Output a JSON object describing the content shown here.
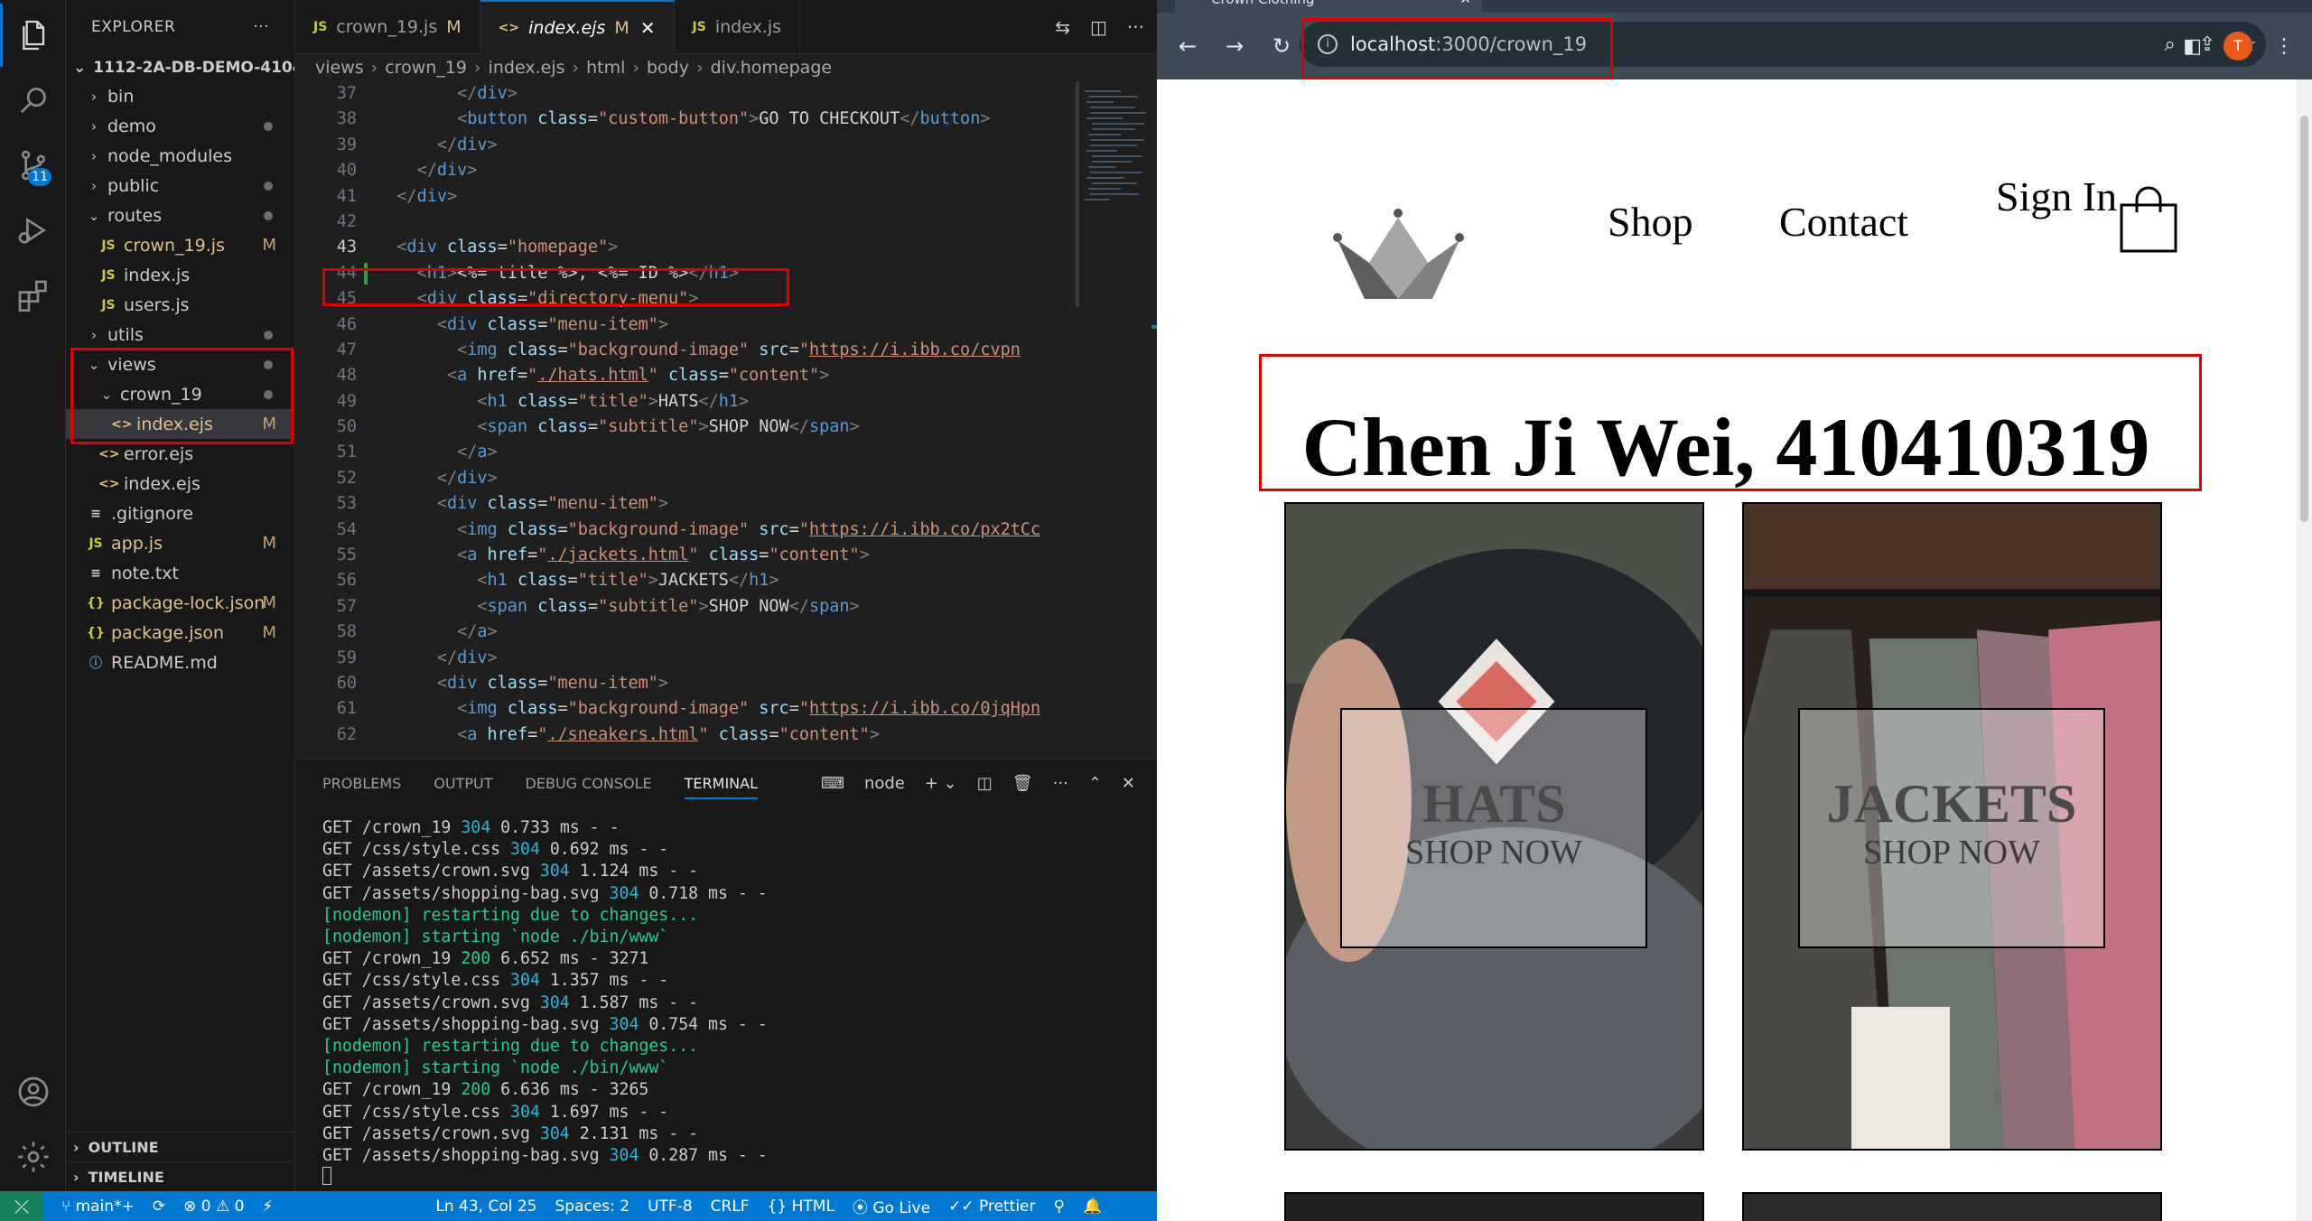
{
  "vscode": {
    "explorer": {
      "header": "EXPLORER",
      "more": "···",
      "project": "1112-2A-DB-DEMO-41041...",
      "tree": [
        {
          "label": "bin",
          "kind": "folder",
          "depth": 1,
          "open": false,
          "status": ""
        },
        {
          "label": "demo",
          "kind": "folder",
          "depth": 1,
          "open": false,
          "status": "dot"
        },
        {
          "label": "node_modules",
          "kind": "folder",
          "depth": 1,
          "open": false,
          "status": ""
        },
        {
          "label": "public",
          "kind": "folder",
          "depth": 1,
          "open": false,
          "status": "dot"
        },
        {
          "label": "routes",
          "kind": "folder",
          "depth": 1,
          "open": true,
          "status": "dot"
        },
        {
          "label": "crown_19.js",
          "kind": "js",
          "depth": 2,
          "status": "M"
        },
        {
          "label": "index.js",
          "kind": "js",
          "depth": 2,
          "status": ""
        },
        {
          "label": "users.js",
          "kind": "js",
          "depth": 2,
          "status": ""
        },
        {
          "label": "utils",
          "kind": "folder",
          "depth": 1,
          "open": false,
          "status": "dot"
        },
        {
          "label": "views",
          "kind": "folder",
          "depth": 1,
          "open": true,
          "status": "dot"
        },
        {
          "label": "crown_19",
          "kind": "folder",
          "depth": 2,
          "open": true,
          "status": "dot"
        },
        {
          "label": "index.ejs",
          "kind": "ejs",
          "depth": 3,
          "status": "M",
          "selected": true
        },
        {
          "label": "error.ejs",
          "kind": "ejs",
          "depth": 2,
          "status": ""
        },
        {
          "label": "index.ejs",
          "kind": "ejs",
          "depth": 2,
          "status": ""
        },
        {
          "label": ".gitignore",
          "kind": "txt",
          "depth": 1,
          "status": ""
        },
        {
          "label": "app.js",
          "kind": "js",
          "depth": 1,
          "status": "M"
        },
        {
          "label": "note.txt",
          "kind": "txt",
          "depth": 1,
          "status": ""
        },
        {
          "label": "package-lock.json",
          "kind": "json",
          "depth": 1,
          "status": "M"
        },
        {
          "label": "package.json",
          "kind": "json",
          "depth": 1,
          "status": "M"
        },
        {
          "label": "README.md",
          "kind": "info",
          "depth": 1,
          "status": ""
        }
      ],
      "outline": "OUTLINE",
      "timeline": "TIMELINE"
    },
    "tabs": [
      {
        "icon": "JS",
        "label": "crown_19.js",
        "mod": "M",
        "active": false
      },
      {
        "icon": "<>",
        "label": "index.ejs",
        "mod": "M",
        "active": true
      },
      {
        "icon": "JS",
        "label": "index.js",
        "mod": "",
        "active": false
      }
    ],
    "breadcrumb": [
      "views",
      "crown_19",
      "index.ejs",
      "html",
      "body",
      "div.homepage"
    ],
    "code": [
      {
        "n": "37",
        "html": "        <span class='tg'>&lt;/</span><span class='tn'>div</span><span class='tg'>&gt;</span>"
      },
      {
        "n": "38",
        "html": "        <span class='tg'>&lt;</span><span class='tn'>button</span> <span class='at'>class</span><span class='tx'>=</span><span class='sv'>\"custom-button\"</span><span class='tg'>&gt;</span><span class='tx'>GO TO CHECKOUT</span><span class='tg'>&lt;/</span><span class='tn'>button</span><span class='tg'>&gt;</span>"
      },
      {
        "n": "39",
        "html": "      <span class='tg'>&lt;/</span><span class='tn'>div</span><span class='tg'>&gt;</span>"
      },
      {
        "n": "40",
        "html": "    <span class='tg'>&lt;/</span><span class='tn'>div</span><span class='tg'>&gt;</span>"
      },
      {
        "n": "41",
        "html": "  <span class='tg'>&lt;/</span><span class='tn'>div</span><span class='tg'>&gt;</span>"
      },
      {
        "n": "42",
        "html": ""
      },
      {
        "n": "43",
        "html": "  <span class='tg'>&lt;</span><span class='tn'>div</span> <span class='at'>class</span><span class='tx'>=</span><span class='sv'>\"homepage\"</span><span class='tg'>&gt;</span>"
      },
      {
        "n": "44",
        "html": "    <span class='tg'>&lt;</span><span class='tn'>h1</span><span class='tg'>&gt;</span><span class='tx'>&lt;%= title %&gt;, &lt;%= ID %&gt;</span><span class='tg'>&lt;/</span><span class='tn'>h1</span><span class='tg'>&gt;</span>"
      },
      {
        "n": "45",
        "html": "    <span class='tg'>&lt;</span><span class='tn'>div</span> <span class='at'>class</span><span class='tx'>=</span><span class='sv'>\"directory-menu\"</span><span class='tg'>&gt;</span>"
      },
      {
        "n": "46",
        "html": "      <span class='tg'>&lt;</span><span class='tn'>div</span> <span class='at'>class</span><span class='tx'>=</span><span class='sv'>\"menu-item\"</span><span class='tg'>&gt;</span>"
      },
      {
        "n": "47",
        "html": "        <span class='tg'>&lt;</span><span class='tn'>img</span> <span class='at'>class</span><span class='tx'>=</span><span class='sv'>\"background-image\"</span> <span class='at'>src</span><span class='tx'>=</span><span class='sv'>\"</span><span class='ul'>https://i.ibb.co/cvpn</span>"
      },
      {
        "n": "48",
        "html": "       <span class='tg'>&lt;</span><span class='tn'>a</span> <span class='at'>href</span><span class='tx'>=</span><span class='sv'>\"</span><span class='ul'>./hats.html</span><span class='sv'>\"</span> <span class='at'>class</span><span class='tx'>=</span><span class='sv'>\"content\"</span><span class='tg'>&gt;</span>"
      },
      {
        "n": "49",
        "html": "          <span class='tg'>&lt;</span><span class='tn'>h1</span> <span class='at'>class</span><span class='tx'>=</span><span class='sv'>\"title\"</span><span class='tg'>&gt;</span><span class='tx'>HATS</span><span class='tg'>&lt;/</span><span class='tn'>h1</span><span class='tg'>&gt;</span>"
      },
      {
        "n": "50",
        "html": "          <span class='tg'>&lt;</span><span class='tn'>span</span> <span class='at'>class</span><span class='tx'>=</span><span class='sv'>\"subtitle\"</span><span class='tg'>&gt;</span><span class='tx'>SHOP NOW</span><span class='tg'>&lt;/</span><span class='tn'>span</span><span class='tg'>&gt;</span>"
      },
      {
        "n": "51",
        "html": "        <span class='tg'>&lt;/</span><span class='tn'>a</span><span class='tg'>&gt;</span>"
      },
      {
        "n": "52",
        "html": "      <span class='tg'>&lt;/</span><span class='tn'>div</span><span class='tg'>&gt;</span>"
      },
      {
        "n": "53",
        "html": "      <span class='tg'>&lt;</span><span class='tn'>div</span> <span class='at'>class</span><span class='tx'>=</span><span class='sv'>\"menu-item\"</span><span class='tg'>&gt;</span>"
      },
      {
        "n": "54",
        "html": "        <span class='tg'>&lt;</span><span class='tn'>img</span> <span class='at'>class</span><span class='tx'>=</span><span class='sv'>\"background-image\"</span> <span class='at'>src</span><span class='tx'>=</span><span class='sv'>\"</span><span class='ul'>https://i.ibb.co/px2tCc</span>"
      },
      {
        "n": "55",
        "html": "        <span class='tg'>&lt;</span><span class='tn'>a</span> <span class='at'>href</span><span class='tx'>=</span><span class='sv'>\"</span><span class='ul'>./jackets.html</span><span class='sv'>\"</span> <span class='at'>class</span><span class='tx'>=</span><span class='sv'>\"content\"</span><span class='tg'>&gt;</span>"
      },
      {
        "n": "56",
        "html": "          <span class='tg'>&lt;</span><span class='tn'>h1</span> <span class='at'>class</span><span class='tx'>=</span><span class='sv'>\"title\"</span><span class='tg'>&gt;</span><span class='tx'>JACKETS</span><span class='tg'>&lt;/</span><span class='tn'>h1</span><span class='tg'>&gt;</span>"
      },
      {
        "n": "57",
        "html": "          <span class='tg'>&lt;</span><span class='tn'>span</span> <span class='at'>class</span><span class='tx'>=</span><span class='sv'>\"subtitle\"</span><span class='tg'>&gt;</span><span class='tx'>SHOP NOW</span><span class='tg'>&lt;/</span><span class='tn'>span</span><span class='tg'>&gt;</span>"
      },
      {
        "n": "58",
        "html": "        <span class='tg'>&lt;/</span><span class='tn'>a</span><span class='tg'>&gt;</span>"
      },
      {
        "n": "59",
        "html": "      <span class='tg'>&lt;/</span><span class='tn'>div</span><span class='tg'>&gt;</span>"
      },
      {
        "n": "60",
        "html": "      <span class='tg'>&lt;</span><span class='tn'>div</span> <span class='at'>class</span><span class='tx'>=</span><span class='sv'>\"menu-item\"</span><span class='tg'>&gt;</span>"
      },
      {
        "n": "61",
        "html": "        <span class='tg'>&lt;</span><span class='tn'>img</span> <span class='at'>class</span><span class='tx'>=</span><span class='sv'>\"background-image\"</span> <span class='at'>src</span><span class='tx'>=</span><span class='sv'>\"</span><span class='ul'>https://i.ibb.co/0jqHpn</span>"
      },
      {
        "n": "62",
        "html": "        <span class='tg'>&lt;</span><span class='tn'>a</span> <span class='at'>href</span><span class='tx'>=</span><span class='sv'>\"</span><span class='ul'>./sneakers.html</span><span class='sv'>\"</span> <span class='at'>class</span><span class='tx'>=</span><span class='sv'>\"content\"</span><span class='tg'>&gt;</span>"
      }
    ],
    "panel": {
      "tabs": [
        "PROBLEMS",
        "OUTPUT",
        "DEBUG CONSOLE",
        "TERMINAL"
      ],
      "active_tab": "TERMINAL",
      "terminal_name": "node",
      "terminal": [
        {
          "pre": "GET /crown_19 ",
          "code": "304",
          "post": " 0.733 ms - -",
          "kind": "req"
        },
        {
          "pre": "GET /css/style.css ",
          "code": "304",
          "post": " 0.692 ms - -",
          "kind": "req"
        },
        {
          "pre": "GET /assets/crown.svg ",
          "code": "304",
          "post": " 1.124 ms - -",
          "kind": "req"
        },
        {
          "pre": "GET /assets/shopping-bag.svg ",
          "code": "304",
          "post": " 0.718 ms - -",
          "kind": "req"
        },
        {
          "pre": "[nodemon] restarting due to changes...",
          "code": "",
          "post": "",
          "kind": "nodemon"
        },
        {
          "pre": "[nodemon] starting `node ./bin/www`",
          "code": "",
          "post": "",
          "kind": "nodemon"
        },
        {
          "pre": "GET /crown_19 ",
          "code": "200",
          "post": " 6.652 ms - 3271",
          "kind": "ok"
        },
        {
          "pre": "GET /css/style.css ",
          "code": "304",
          "post": " 1.357 ms - -",
          "kind": "req"
        },
        {
          "pre": "GET /assets/crown.svg ",
          "code": "304",
          "post": " 1.587 ms - -",
          "kind": "req"
        },
        {
          "pre": "GET /assets/shopping-bag.svg ",
          "code": "304",
          "post": " 0.754 ms - -",
          "kind": "req"
        },
        {
          "pre": "[nodemon] restarting due to changes...",
          "code": "",
          "post": "",
          "kind": "nodemon"
        },
        {
          "pre": "[nodemon] starting `node ./bin/www`",
          "code": "",
          "post": "",
          "kind": "nodemon"
        },
        {
          "pre": "GET /crown_19 ",
          "code": "200",
          "post": " 6.636 ms - 3265",
          "kind": "ok"
        },
        {
          "pre": "GET /css/style.css ",
          "code": "304",
          "post": " 1.697 ms - -",
          "kind": "req"
        },
        {
          "pre": "GET /assets/crown.svg ",
          "code": "304",
          "post": " 2.131 ms - -",
          "kind": "req"
        },
        {
          "pre": "GET /assets/shopping-bag.svg ",
          "code": "304",
          "post": " 0.287 ms - -",
          "kind": "req"
        }
      ]
    },
    "status": {
      "branch": "main*+",
      "sync": "⟳",
      "errors": "⊗ 0 ⚠ 0",
      "position": "Ln 43, Col 25",
      "spaces": "Spaces: 2",
      "encoding": "UTF-8",
      "eol": "CRLF",
      "language": "HTML",
      "golive": "Go Live",
      "prettier": "Prettier"
    },
    "scm_badge": "11"
  },
  "browser": {
    "tab_title": "Crown Clothing",
    "url_host": "localhost",
    "url_path": ":3000/crown_19",
    "profile_initial": "T",
    "page": {
      "nav": {
        "shop": "Shop",
        "contact": "Contact",
        "signin": "Sign In"
      },
      "title": "Chen Ji Wei, 410410319",
      "menu_items": [
        {
          "title": "HATS",
          "subtitle": "SHOP NOW"
        },
        {
          "title": "JACKETS",
          "subtitle": "SHOP NOW"
        }
      ]
    }
  },
  "colors": {
    "highlight": "#e00000",
    "vscode_accent": "#0078d4",
    "browser_toolbar": "#3c4b56"
  }
}
